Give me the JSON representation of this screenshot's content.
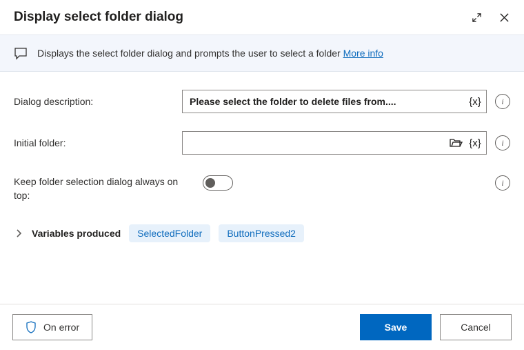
{
  "header": {
    "title": "Display select folder dialog"
  },
  "info": {
    "text": "Displays the select folder dialog and prompts the user to select a folder",
    "link": "More info"
  },
  "fields": {
    "description": {
      "label": "Dialog description:",
      "value": "Please select the folder to delete files from....",
      "var_token": "{x}"
    },
    "initial_folder": {
      "label": "Initial folder:",
      "value": "",
      "var_token": "{x}"
    },
    "always_on_top": {
      "label": "Keep folder selection dialog always on top:",
      "state": "off"
    }
  },
  "variables": {
    "label": "Variables produced",
    "chips": [
      "SelectedFolder",
      "ButtonPressed2"
    ]
  },
  "footer": {
    "on_error": "On error",
    "save": "Save",
    "cancel": "Cancel"
  }
}
